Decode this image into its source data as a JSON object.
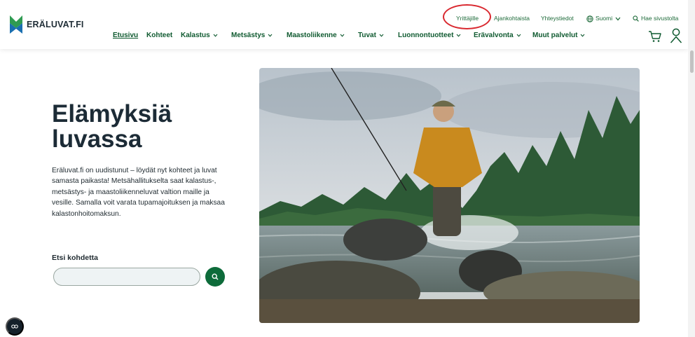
{
  "brand": {
    "name": "ERÄLUVAT.FI"
  },
  "utility_nav": {
    "yrittajille": "Yrittäjille",
    "ajankohtaista": "Ajankohtaista",
    "yhteystiedot": "Yhteystiedot",
    "language": "Suomi",
    "search": "Hae sivustolta"
  },
  "main_nav": [
    {
      "label": "Etusivu"
    },
    {
      "label": "Kohteet"
    },
    {
      "label": "Kalastus"
    },
    {
      "label": "Metsästys"
    },
    {
      "label": "Maastoliikenne"
    },
    {
      "label": "Tuvat"
    },
    {
      "label": "Luonnontuotteet"
    },
    {
      "label": "Erävalvonta"
    },
    {
      "label": "Muut palvelut"
    }
  ],
  "hero": {
    "title": "Elämyksiä luvassa",
    "text": "Eräluvat.fi on uudistunut – löydät nyt kohteet ja luvat samasta paikasta! Metsähallitukselta saat kalastus-, metsästys- ja maastoliikenneluvat valtion maille ja vesille. Samalla voit varata tupamajoituksen ja maksaa kalastonhoitomaksun."
  },
  "search": {
    "label": "Etsi kohdetta",
    "value": "",
    "placeholder": ""
  },
  "colors": {
    "brand_green": "#0f5a30",
    "accent_green": "#0d6b3a",
    "annotation": "#d9282f"
  },
  "icons": [
    "globe-icon",
    "chevron-down-icon",
    "search-icon",
    "cart-icon",
    "user-icon",
    "cookie-icon"
  ]
}
